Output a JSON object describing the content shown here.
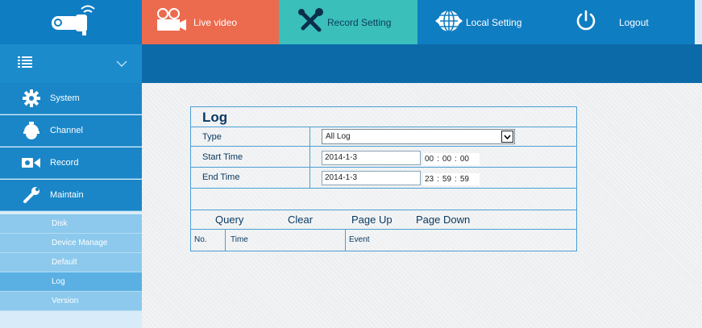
{
  "nav": {
    "live_label": "Live video",
    "record_label": "Record Setting",
    "local_label": "Local Setting",
    "logout_label": "Logout"
  },
  "sidebar": {
    "items": [
      {
        "label": "System",
        "icon": "gear-icon"
      },
      {
        "label": "Channel",
        "icon": "dome-camera-icon"
      },
      {
        "label": "Record",
        "icon": "video-record-icon"
      },
      {
        "label": "Maintain",
        "icon": "wrench-icon"
      }
    ],
    "subitems": [
      {
        "label": "Disk"
      },
      {
        "label": "Device Manage"
      },
      {
        "label": "Default"
      },
      {
        "label": "Log"
      },
      {
        "label": "Version"
      }
    ]
  },
  "log": {
    "title": "Log",
    "type_label": "Type",
    "type_value": "All Log",
    "start_label": "Start Time",
    "start_date": "2014-1-3",
    "start_h": "00",
    "start_m": "00",
    "start_s": "00",
    "end_label": "End Time",
    "end_date": "2014-1-3",
    "end_h": "23",
    "end_m": "59",
    "end_s": "59",
    "sep": ":",
    "buttons": {
      "query": "Query",
      "clear": "Clear",
      "page_up": "Page Up",
      "page_down": "Page Down"
    },
    "columns": {
      "no": "No.",
      "time": "Time",
      "event": "Event"
    }
  },
  "colors": {
    "header_blue": "#0f7dc2",
    "live_tab": "#ec6a4e",
    "record_tab": "#3bbfbb",
    "band_blue": "#0d6aa8"
  }
}
